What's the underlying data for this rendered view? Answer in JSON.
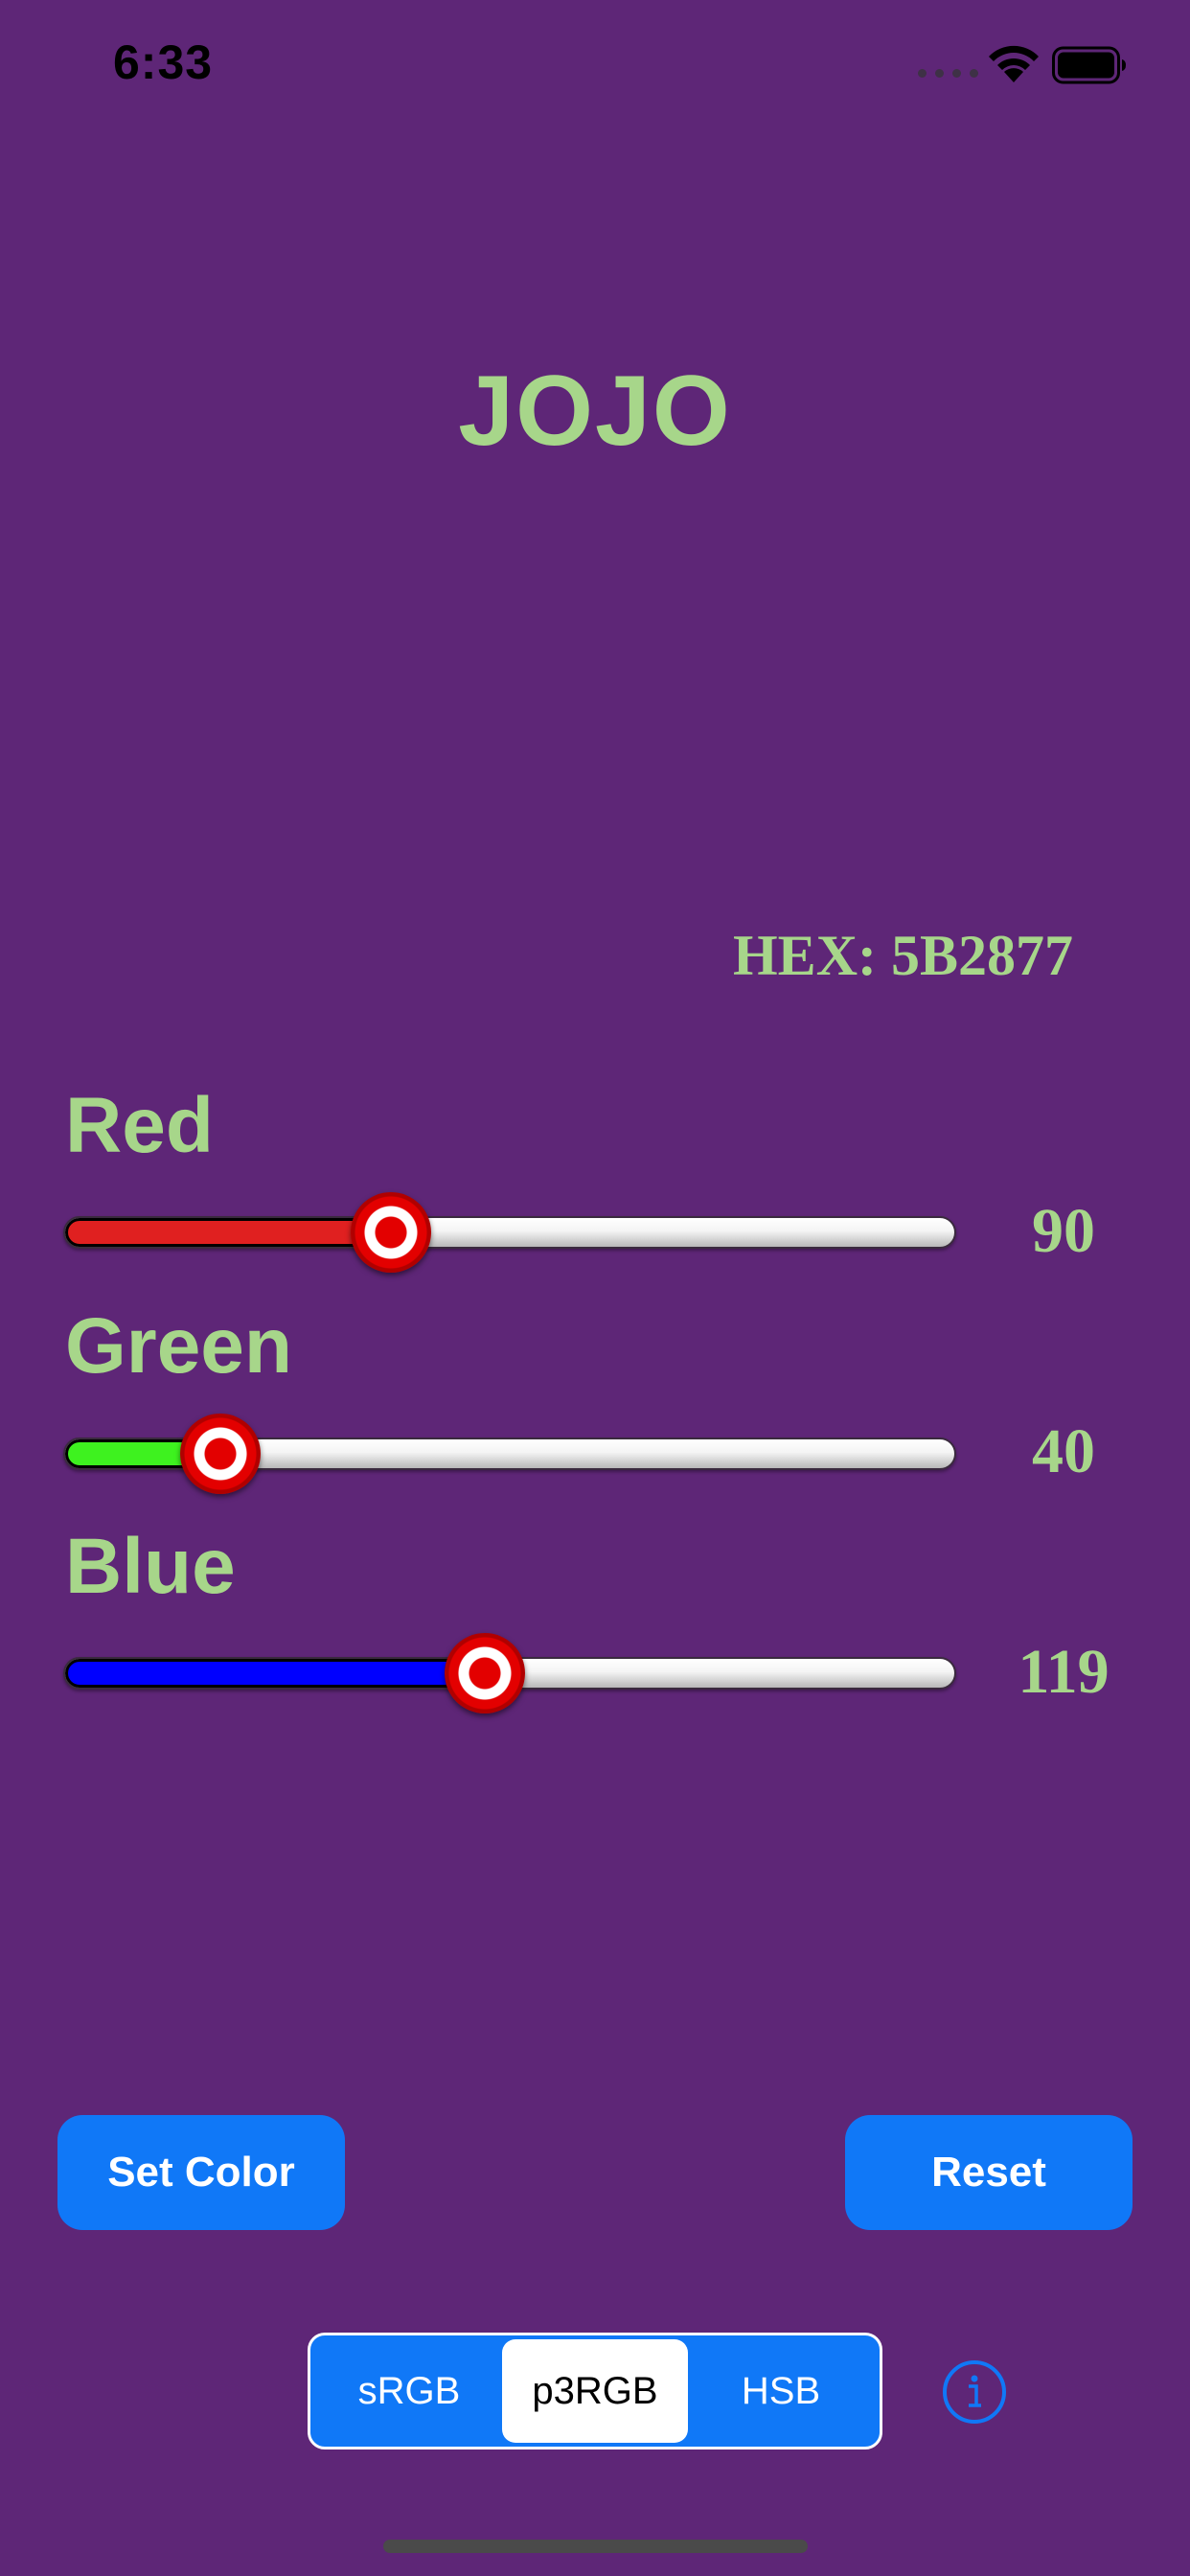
{
  "status_bar": {
    "time": "6:33"
  },
  "title": "JOJO",
  "hex": {
    "label": "HEX: 5B2877"
  },
  "sliders": [
    {
      "label": "Red",
      "value": "90",
      "fraction": 0.367,
      "fill_color": "#e02020"
    },
    {
      "label": "Green",
      "value": "40",
      "fraction": 0.176,
      "fill_color": "#3ef21f"
    },
    {
      "label": "Blue",
      "value": "119",
      "fraction": 0.472,
      "fill_color": "#0000ff"
    }
  ],
  "buttons": {
    "set_color": "Set Color",
    "reset": "Reset"
  },
  "color_space": {
    "options": [
      "sRGB",
      "p3RGB",
      "HSB"
    ],
    "selected": "p3RGB"
  },
  "colors": {
    "background": "#5e2677",
    "accent": "#1078f7",
    "label": "#a7d68a"
  }
}
